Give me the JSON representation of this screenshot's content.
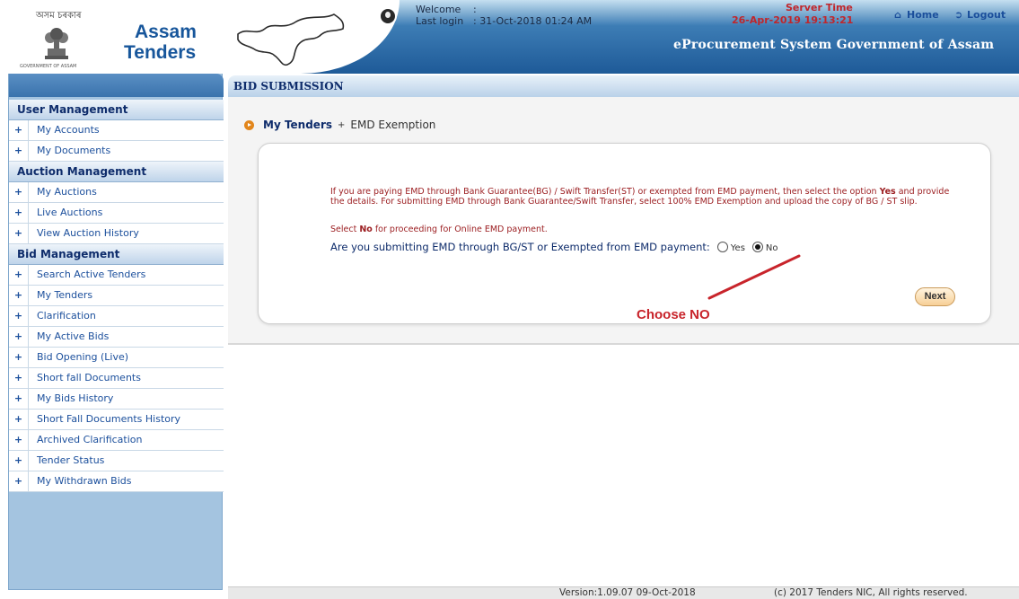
{
  "header": {
    "logo_assamese": "অসম চৰকাৰ",
    "logo_caption": "GOVERNMENT OF ASSAM",
    "brand_line1": "Assam",
    "brand_line2": "Tenders",
    "welcome_label": "Welcome",
    "welcome_colon": ":",
    "last_login_label": "Last login",
    "last_login_value": ": 31-Oct-2018 01:24 AM",
    "server_time_label": "Server Time",
    "server_time_value": "26-Apr-2019 19:13:21",
    "home_label": "Home",
    "logout_label": "Logout",
    "system_title": "eProcurement System Government of Assam"
  },
  "sidebar": {
    "sections": [
      {
        "title": "User Management",
        "items": [
          "My Accounts",
          "My Documents"
        ]
      },
      {
        "title": "Auction Management",
        "items": [
          "My Auctions",
          "Live Auctions",
          "View Auction History"
        ]
      },
      {
        "title": "Bid Management",
        "items": [
          "Search Active Tenders",
          "My Tenders",
          "Clarification",
          "My Active Bids",
          "Bid Opening (Live)",
          "Short fall Documents",
          "My Bids History",
          "Short Fall Documents History",
          "Archived Clarification",
          "Tender Status",
          "My Withdrawn Bids"
        ]
      }
    ]
  },
  "main": {
    "title": "BID SUBMISSION",
    "breadcrumb": [
      "My Tenders",
      "EMD Exemption"
    ],
    "breadcrumb_sep": "+",
    "notice_pre": "If you are paying EMD through Bank Guarantee(BG) / Swift Transfer(ST) or exempted from EMD payment, then select the option ",
    "notice_bold": "Yes",
    "notice_post": " and provide the details. For submitting EMD through Bank Guarantee/Swift Transfer, select 100% EMD Exemption and upload the copy of BG / ST slip.",
    "hint_pre": "Select ",
    "hint_bold": "No",
    "hint_post": " for proceeding for Online EMD payment.",
    "question": "Are you submitting EMD through BG/ST or Exempted from EMD payment:",
    "option_yes": "Yes",
    "option_no": "No",
    "selected": "No",
    "next_label": "Next",
    "annotation": "Choose NO"
  },
  "footer": {
    "version": "Version:1.09.07 09-Oct-2018",
    "copyright": "(c) 2017 Tenders NIC, All rights reserved."
  },
  "colors": {
    "brand_blue": "#17569b",
    "server_red": "#c0262b",
    "notice_red": "#9c1f22",
    "annotation_red": "#c8242b",
    "sidebar_bg": "#a4c4e0"
  },
  "icons": {
    "home": "home-icon",
    "logout": "logout-icon",
    "user": "user-avatar-icon",
    "breadcrumb": "breadcrumb-bullet-icon",
    "nav_bullet": "plus-bullet-icon"
  }
}
